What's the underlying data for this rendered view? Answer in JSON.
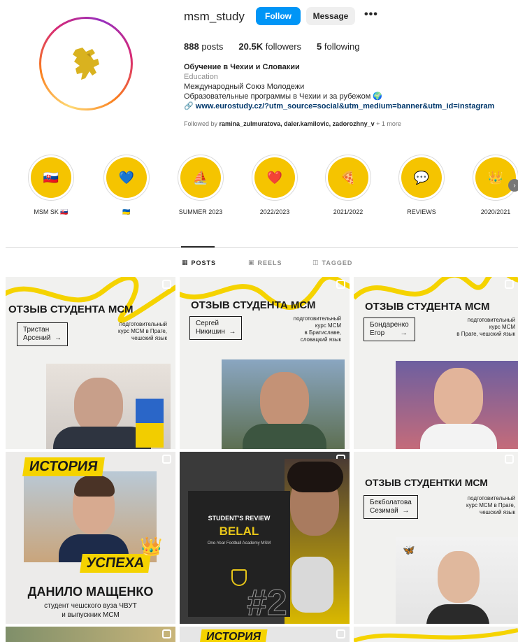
{
  "profile": {
    "username": "msm_study",
    "follow_label": "Follow",
    "message_label": "Message",
    "more_label": "•••",
    "posts_count": "888",
    "posts_label": "posts",
    "followers_count": "20.5K",
    "followers_label": "followers",
    "following_count": "5",
    "following_label": "following",
    "display_name": "Обучение в Чехии и Словакии",
    "category": "Education",
    "bio_line1": "Международный Союз Молодежи",
    "bio_line2": "Образовательные программы в Чехии и за рубежом 🌍",
    "link": "www.eurostudy.cz/?utm_source=social&utm_medium=banner&utm_id=instagram",
    "followed_prefix": "Followed by",
    "followed_names": "ramina_zulmuratova, daler.kamilovic, zadorozhny_v",
    "followed_more": "+ 1 more"
  },
  "highlights": [
    {
      "label": "MSM SK 🇸🇰",
      "icon": "🇸🇰"
    },
    {
      "label": "🇺🇦",
      "icon": "💙"
    },
    {
      "label": "SUMMER 2023",
      "icon": "⛵"
    },
    {
      "label": "2022/2023",
      "icon": "❤️"
    },
    {
      "label": "2021/2022",
      "icon": "🍕"
    },
    {
      "label": "REVIEWS",
      "icon": "💬"
    },
    {
      "label": "2020/2021",
      "icon": "👑"
    }
  ],
  "tabs": {
    "posts": "POSTS",
    "reels": "REELS",
    "tagged": "TAGGED"
  },
  "posts": [
    {
      "title": "ОТЗЫВ СТУДЕНТА МСМ",
      "name": "Тристан\nАрсений  →",
      "desc": "подготовительный\nкурс МСМ в Праге,\nчешский язык"
    },
    {
      "title": "ОТЗЫВ СТУДЕНТА МСМ",
      "name": "Сергей\nНикишин  →",
      "desc": "подготовительный\nкурс МСМ\nв Братиславе,\nсловацкий язык"
    },
    {
      "title": "ОТЗЫВ СТУДЕНТА МСМ",
      "name": "Бондаренко\nЕгор        →",
      "desc": "подготовительный\nкурс МСМ\nв Праге, чешский язык"
    },
    {
      "tag_top": "ИСТОРИЯ",
      "tag_bottom": "УСПЕХА",
      "name": "ДАНИЛО МАЩЕНКО",
      "desc": "студент чешского вуза ЧВУТ\nи выпускник МСМ"
    },
    {
      "review_label": "STUDENT'S REVIEW",
      "name": "BELAL",
      "sub": "One-Year Football Academy MSM",
      "number": "#2"
    },
    {
      "title": "ОТЗЫВ СТУДЕНТКИ МСМ",
      "name": "Бекболатова\nСезимай  →",
      "desc": "подготовительный\nкурс МСМ в Праге,\nчешский язык"
    }
  ],
  "row3": {
    "tag": "ИСТОРИЯ"
  },
  "colors": {
    "accent": "#0095f6",
    "yellow": "#f5c400"
  }
}
